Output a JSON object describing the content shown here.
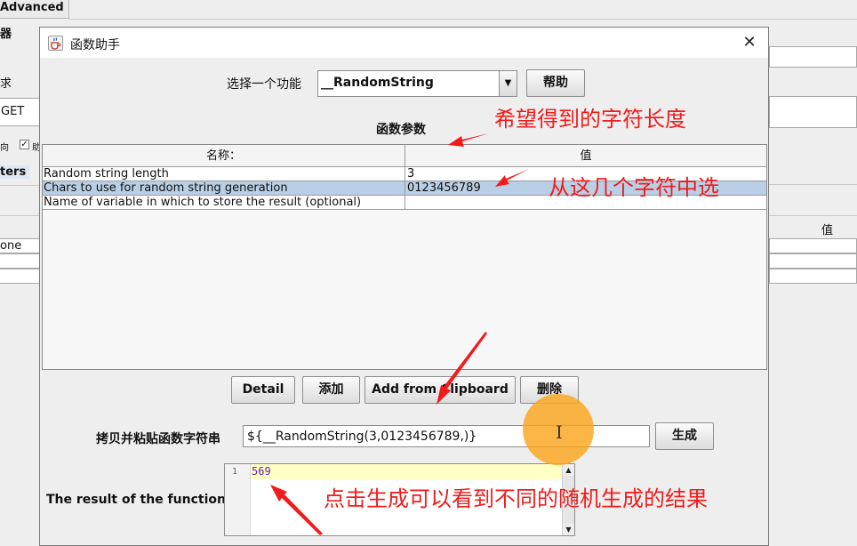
{
  "background": {
    "tab_advanced": "Advanced",
    "fragment_1": "器",
    "fragment_2": "求",
    "method_value": "GET",
    "fragment_3": "向",
    "fragment_4": "助",
    "tab_parameters": "ters",
    "column_value": "值",
    "row_none": "one"
  },
  "dialog": {
    "title": "函数助手",
    "select_label": "选择一个功能",
    "selected_function": "__RandomString",
    "help_button": "帮助",
    "params_title": "函数参数",
    "table": {
      "headers": [
        "名称：",
        "值"
      ],
      "rows": [
        {
          "name": "Random string length",
          "value": "3",
          "selected": false
        },
        {
          "name": "Chars to use for random string generation",
          "value": "0123456789",
          "selected": true
        },
        {
          "name": "Name of variable in which to store the result (optional)",
          "value": "",
          "selected": false
        }
      ]
    },
    "buttons": {
      "detail": "Detail",
      "add": "添加",
      "add_from_clipboard": "Add from Clipboard",
      "delete": "删除"
    },
    "function_string_label": "拷贝并粘贴函数字符串",
    "function_string_value": "${__RandomString(3,0123456789,)}",
    "generate_button": "生成",
    "result_label": "The result of the function is",
    "result_line_number": "1",
    "result_value": "569"
  },
  "annotations": {
    "length_note": "希望得到的字符长度",
    "chars_note": "从这几个字符中选",
    "generate_note": "点击生成可以看到不同的随机生成的结果",
    "color": "#f21b1b"
  },
  "icons": {
    "title_icon": "java-cup-icon",
    "close": "close-icon",
    "combo_arrow": "chevron-down-icon",
    "cursor": "text-cursor-icon"
  }
}
